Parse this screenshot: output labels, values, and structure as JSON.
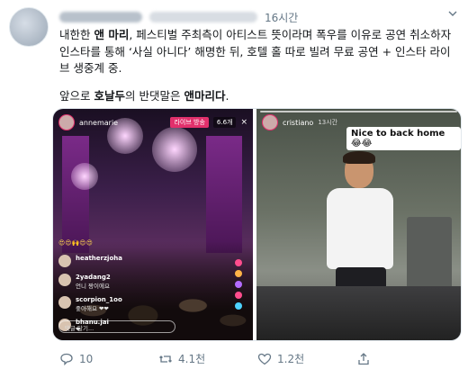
{
  "tweet": {
    "time": "16시간",
    "text": {
      "line1": [
        {
          "t": "내한한 ",
          "b": false
        },
        {
          "t": "앤 마리",
          "b": true
        },
        {
          "t": ", 페스티벌 주최측이 아티스트 뜻이라며 폭우를 이유로 공연 취소하자 인스타를 통해 ‘사실 아니다’ 해명한 뒤, 호텔 홀 따로 빌려 무료 공연 + 인스타 라이브 생중계 중.",
          "b": false
        }
      ],
      "line2": [
        {
          "t": "앞으로 ",
          "b": false
        },
        {
          "t": "호날두",
          "b": true
        },
        {
          "t": "의 반댓말은 ",
          "b": false
        },
        {
          "t": "앤마리다",
          "b": true
        },
        {
          "t": ".",
          "b": false
        }
      ]
    },
    "media": {
      "left": {
        "username": "annemarie",
        "live_badge": "라이브 방송",
        "viewers": "6.6개",
        "close": "×",
        "emoji_row": "😍😍🙌😍😍",
        "comments": [
          {
            "user": "heatherzjoha",
            "msg": ""
          },
          {
            "user": "2yadang2",
            "msg": "언니 짱이에요"
          },
          {
            "user": "scorpion_1oo",
            "msg": "좋아해요 ❤❤"
          },
          {
            "user": "bhanu.jai",
            "msg": "❤"
          }
        ],
        "comment_placeholder": "댓글 달기..."
      },
      "right": {
        "username": "cristiano",
        "time": "13시간",
        "caption": "Nice to back home 😂😂"
      }
    },
    "actions": {
      "reply": "10",
      "retweet": "4.1천",
      "like": "1.2천"
    }
  }
}
